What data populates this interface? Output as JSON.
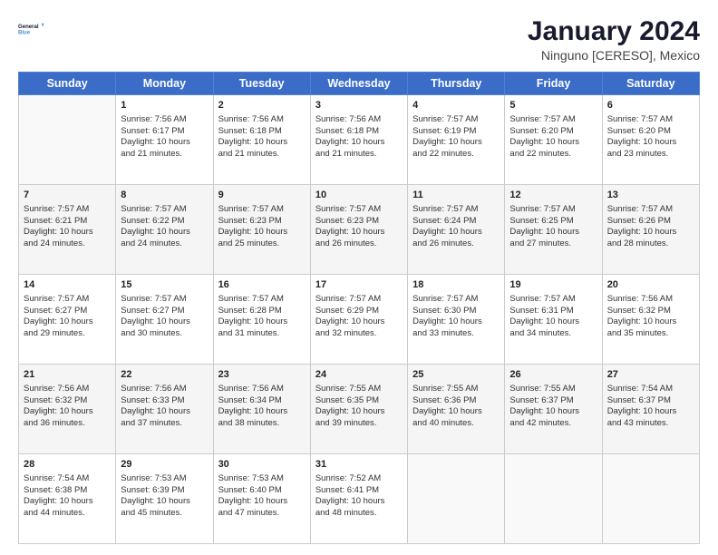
{
  "header": {
    "logo_line1": "General",
    "logo_line2": "Blue",
    "main_title": "January 2024",
    "subtitle": "Ninguno [CERESO], Mexico"
  },
  "days_of_week": [
    "Sunday",
    "Monday",
    "Tuesday",
    "Wednesday",
    "Thursday",
    "Friday",
    "Saturday"
  ],
  "weeks": [
    [
      {
        "day": "",
        "info": ""
      },
      {
        "day": "1",
        "info": "Sunrise: 7:56 AM\nSunset: 6:17 PM\nDaylight: 10 hours\nand 21 minutes."
      },
      {
        "day": "2",
        "info": "Sunrise: 7:56 AM\nSunset: 6:18 PM\nDaylight: 10 hours\nand 21 minutes."
      },
      {
        "day": "3",
        "info": "Sunrise: 7:56 AM\nSunset: 6:18 PM\nDaylight: 10 hours\nand 21 minutes."
      },
      {
        "day": "4",
        "info": "Sunrise: 7:57 AM\nSunset: 6:19 PM\nDaylight: 10 hours\nand 22 minutes."
      },
      {
        "day": "5",
        "info": "Sunrise: 7:57 AM\nSunset: 6:20 PM\nDaylight: 10 hours\nand 22 minutes."
      },
      {
        "day": "6",
        "info": "Sunrise: 7:57 AM\nSunset: 6:20 PM\nDaylight: 10 hours\nand 23 minutes."
      }
    ],
    [
      {
        "day": "7",
        "info": "Sunrise: 7:57 AM\nSunset: 6:21 PM\nDaylight: 10 hours\nand 24 minutes."
      },
      {
        "day": "8",
        "info": "Sunrise: 7:57 AM\nSunset: 6:22 PM\nDaylight: 10 hours\nand 24 minutes."
      },
      {
        "day": "9",
        "info": "Sunrise: 7:57 AM\nSunset: 6:23 PM\nDaylight: 10 hours\nand 25 minutes."
      },
      {
        "day": "10",
        "info": "Sunrise: 7:57 AM\nSunset: 6:23 PM\nDaylight: 10 hours\nand 26 minutes."
      },
      {
        "day": "11",
        "info": "Sunrise: 7:57 AM\nSunset: 6:24 PM\nDaylight: 10 hours\nand 26 minutes."
      },
      {
        "day": "12",
        "info": "Sunrise: 7:57 AM\nSunset: 6:25 PM\nDaylight: 10 hours\nand 27 minutes."
      },
      {
        "day": "13",
        "info": "Sunrise: 7:57 AM\nSunset: 6:26 PM\nDaylight: 10 hours\nand 28 minutes."
      }
    ],
    [
      {
        "day": "14",
        "info": "Sunrise: 7:57 AM\nSunset: 6:27 PM\nDaylight: 10 hours\nand 29 minutes."
      },
      {
        "day": "15",
        "info": "Sunrise: 7:57 AM\nSunset: 6:27 PM\nDaylight: 10 hours\nand 30 minutes."
      },
      {
        "day": "16",
        "info": "Sunrise: 7:57 AM\nSunset: 6:28 PM\nDaylight: 10 hours\nand 31 minutes."
      },
      {
        "day": "17",
        "info": "Sunrise: 7:57 AM\nSunset: 6:29 PM\nDaylight: 10 hours\nand 32 minutes."
      },
      {
        "day": "18",
        "info": "Sunrise: 7:57 AM\nSunset: 6:30 PM\nDaylight: 10 hours\nand 33 minutes."
      },
      {
        "day": "19",
        "info": "Sunrise: 7:57 AM\nSunset: 6:31 PM\nDaylight: 10 hours\nand 34 minutes."
      },
      {
        "day": "20",
        "info": "Sunrise: 7:56 AM\nSunset: 6:32 PM\nDaylight: 10 hours\nand 35 minutes."
      }
    ],
    [
      {
        "day": "21",
        "info": "Sunrise: 7:56 AM\nSunset: 6:32 PM\nDaylight: 10 hours\nand 36 minutes."
      },
      {
        "day": "22",
        "info": "Sunrise: 7:56 AM\nSunset: 6:33 PM\nDaylight: 10 hours\nand 37 minutes."
      },
      {
        "day": "23",
        "info": "Sunrise: 7:56 AM\nSunset: 6:34 PM\nDaylight: 10 hours\nand 38 minutes."
      },
      {
        "day": "24",
        "info": "Sunrise: 7:55 AM\nSunset: 6:35 PM\nDaylight: 10 hours\nand 39 minutes."
      },
      {
        "day": "25",
        "info": "Sunrise: 7:55 AM\nSunset: 6:36 PM\nDaylight: 10 hours\nand 40 minutes."
      },
      {
        "day": "26",
        "info": "Sunrise: 7:55 AM\nSunset: 6:37 PM\nDaylight: 10 hours\nand 42 minutes."
      },
      {
        "day": "27",
        "info": "Sunrise: 7:54 AM\nSunset: 6:37 PM\nDaylight: 10 hours\nand 43 minutes."
      }
    ],
    [
      {
        "day": "28",
        "info": "Sunrise: 7:54 AM\nSunset: 6:38 PM\nDaylight: 10 hours\nand 44 minutes."
      },
      {
        "day": "29",
        "info": "Sunrise: 7:53 AM\nSunset: 6:39 PM\nDaylight: 10 hours\nand 45 minutes."
      },
      {
        "day": "30",
        "info": "Sunrise: 7:53 AM\nSunset: 6:40 PM\nDaylight: 10 hours\nand 47 minutes."
      },
      {
        "day": "31",
        "info": "Sunrise: 7:52 AM\nSunset: 6:41 PM\nDaylight: 10 hours\nand 48 minutes."
      },
      {
        "day": "",
        "info": ""
      },
      {
        "day": "",
        "info": ""
      },
      {
        "day": "",
        "info": ""
      }
    ]
  ]
}
